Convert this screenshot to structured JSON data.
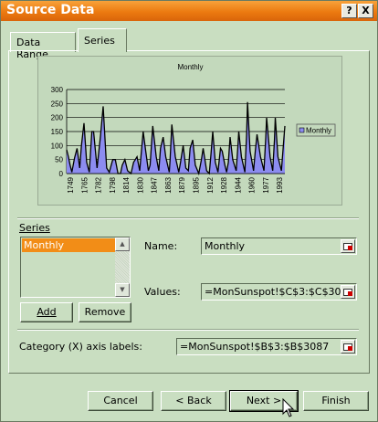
{
  "title": "Source Data",
  "title_buttons": {
    "help": "?",
    "close": "X"
  },
  "tabs": [
    "Data Range",
    "Series"
  ],
  "chart_data": {
    "type": "area",
    "title": "Monthly",
    "legend": [
      "Monthly"
    ],
    "legend_position": "right",
    "ylim": [
      0,
      300
    ],
    "yticks": [
      "300",
      "250",
      "200",
      "150",
      "100",
      "50",
      "0"
    ],
    "xticks": [
      "1749",
      "1765",
      "1782",
      "1798",
      "1814",
      "1830",
      "1847",
      "1863",
      "1879",
      "1895",
      "1912",
      "1928",
      "1944",
      "1960",
      "1977",
      "1993"
    ],
    "grid": true,
    "series": [
      {
        "name": "Monthly",
        "x": [
          1749,
          1751,
          1753,
          1755,
          1758,
          1761,
          1764,
          1766,
          1769,
          1772,
          1775,
          1778,
          1780,
          1784,
          1788,
          1791,
          1795,
          1798,
          1802,
          1805,
          1808,
          1811,
          1813,
          1816,
          1819,
          1823,
          1826,
          1830,
          1833,
          1837,
          1840,
          1843,
          1845,
          1848,
          1852,
          1855,
          1857,
          1860,
          1863,
          1867,
          1868,
          1870,
          1874,
          1878,
          1880,
          1883,
          1886,
          1889,
          1891,
          1894,
          1897,
          1901,
          1904,
          1906,
          1910,
          1913,
          1915,
          1917,
          1920,
          1923,
          1926,
          1928,
          1931,
          1933,
          1935,
          1937,
          1940,
          1944,
          1946,
          1947,
          1950,
          1954,
          1956,
          1957,
          1960,
          1964,
          1966,
          1968,
          1972,
          1976,
          1978,
          1979,
          1983,
          1986,
          1988,
          1989,
          1992,
          1996,
          1998,
          2000
        ],
        "values": [
          85,
          60,
          30,
          5,
          55,
          90,
          20,
          100,
          180,
          40,
          5,
          150,
          150,
          20,
          135,
          240,
          20,
          5,
          50,
          50,
          0,
          0,
          30,
          50,
          10,
          0,
          40,
          60,
          10,
          150,
          80,
          10,
          30,
          170,
          60,
          10,
          90,
          130,
          60,
          5,
          50,
          175,
          60,
          5,
          40,
          100,
          20,
          10,
          90,
          120,
          30,
          0,
          50,
          90,
          10,
          0,
          70,
          150,
          40,
          5,
          90,
          80,
          30,
          5,
          40,
          130,
          50,
          10,
          100,
          150,
          60,
          5,
          140,
          255,
          80,
          10,
          80,
          140,
          60,
          10,
          130,
          200,
          60,
          10,
          120,
          200,
          60,
          10,
          90,
          170
        ]
      }
    ]
  },
  "series_section": {
    "heading": "Series",
    "items": [
      "Monthly"
    ],
    "add_label": "Add",
    "remove_label": "Remove"
  },
  "name_field": {
    "label": "Name:",
    "value": "Monthly"
  },
  "values_field": {
    "label": "Values:",
    "value": "=MonSunspot!$C$3:$C$3087"
  },
  "category_field": {
    "label": "Category (X) axis labels:",
    "value": "=MonSunspot!$B$3:$B$3087"
  },
  "footer": {
    "cancel": "Cancel",
    "back": "< Back",
    "next": "Next >",
    "finish": "Finish"
  }
}
